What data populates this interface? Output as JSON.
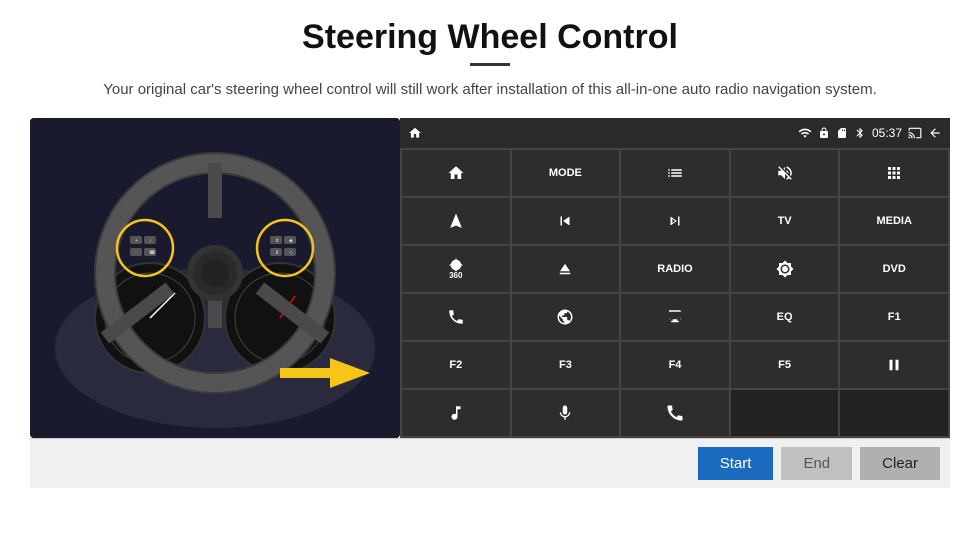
{
  "page": {
    "title": "Steering Wheel Control",
    "subtitle": "Your original car's steering wheel control will still work after installation of this all-in-one auto radio navigation system."
  },
  "status_bar": {
    "time": "05:37",
    "icons": [
      "wifi",
      "lock",
      "sd",
      "bluetooth",
      "cast",
      "back"
    ]
  },
  "buttons": [
    {
      "id": "home",
      "type": "icon",
      "icon": "home"
    },
    {
      "id": "mode",
      "type": "text",
      "label": "MODE"
    },
    {
      "id": "list",
      "type": "icon",
      "icon": "list"
    },
    {
      "id": "mute",
      "type": "icon",
      "icon": "mute"
    },
    {
      "id": "apps",
      "type": "icon",
      "icon": "apps"
    },
    {
      "id": "nav",
      "type": "icon",
      "icon": "nav"
    },
    {
      "id": "prev",
      "type": "icon",
      "icon": "prev"
    },
    {
      "id": "next",
      "type": "icon",
      "icon": "next"
    },
    {
      "id": "tv",
      "type": "text",
      "label": "TV"
    },
    {
      "id": "media",
      "type": "text",
      "label": "MEDIA"
    },
    {
      "id": "cam360",
      "type": "icon",
      "icon": "360cam"
    },
    {
      "id": "eject",
      "type": "icon",
      "icon": "eject"
    },
    {
      "id": "radio",
      "type": "text",
      "label": "RADIO"
    },
    {
      "id": "brightness",
      "type": "icon",
      "icon": "brightness"
    },
    {
      "id": "dvd",
      "type": "text",
      "label": "DVD"
    },
    {
      "id": "phone",
      "type": "icon",
      "icon": "phone"
    },
    {
      "id": "web",
      "type": "icon",
      "icon": "web"
    },
    {
      "id": "screen",
      "type": "icon",
      "icon": "screen"
    },
    {
      "id": "eq",
      "type": "text",
      "label": "EQ"
    },
    {
      "id": "f1",
      "type": "text",
      "label": "F1"
    },
    {
      "id": "f2",
      "type": "text",
      "label": "F2"
    },
    {
      "id": "f3",
      "type": "text",
      "label": "F3"
    },
    {
      "id": "f4",
      "type": "text",
      "label": "F4"
    },
    {
      "id": "f5",
      "type": "text",
      "label": "F5"
    },
    {
      "id": "playpause",
      "type": "icon",
      "icon": "playpause"
    },
    {
      "id": "music",
      "type": "icon",
      "icon": "music"
    },
    {
      "id": "mic",
      "type": "icon",
      "icon": "mic"
    },
    {
      "id": "callend",
      "type": "icon",
      "icon": "callend"
    },
    {
      "id": "empty1",
      "type": "empty",
      "label": ""
    },
    {
      "id": "empty2",
      "type": "empty",
      "label": ""
    }
  ],
  "action_buttons": {
    "start": "Start",
    "end": "End",
    "clear": "Clear"
  }
}
